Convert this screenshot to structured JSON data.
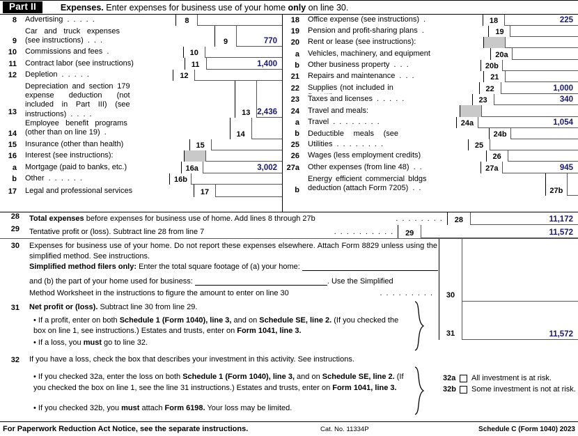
{
  "header": {
    "part_badge": "Part II",
    "title_bold": "Expenses.",
    "title_rest": " Enter expenses for business use of your home ",
    "title_bold2": "only",
    "title_end": " on line 30."
  },
  "left_column": [
    {
      "num": "8",
      "desc": "Advertising",
      "dots": 5,
      "linebox": "8",
      "amount": ""
    },
    {
      "num": "9",
      "desc": "Car and truck expenses (see instructions)",
      "dots": 3,
      "linebox": "9",
      "amount": "770"
    },
    {
      "num": "10",
      "desc": "Commissions and fees",
      "dots": 1,
      "linebox": "10",
      "amount": ""
    },
    {
      "num": "11",
      "desc": "Contract labor (see instructions)",
      "dots": 0,
      "linebox": "11",
      "amount": "1,400"
    },
    {
      "num": "12",
      "desc": "Depletion",
      "dots": 5,
      "linebox": "12",
      "amount": ""
    },
    {
      "num": "13",
      "desc": "Depreciation and section 179 expense deduction (not included in Part III) (see instructions)",
      "dots": 4,
      "linebox": "13",
      "amount": "2,436"
    },
    {
      "num": "14",
      "desc": "Employee benefit programs (other than on line 19)",
      "dots": 1,
      "linebox": "14",
      "amount": ""
    },
    {
      "num": "15",
      "desc": "Insurance (other than health)",
      "dots": 0,
      "linebox": "15",
      "amount": ""
    },
    {
      "num": "16",
      "desc": "Interest (see instructions):",
      "dots": 0,
      "linebox": "",
      "shaded": true,
      "amount": ""
    },
    {
      "num": "a",
      "desc": "Mortgage (paid to banks, etc.)",
      "dots": 0,
      "linebox": "16a",
      "amount": "3,002"
    },
    {
      "num": "b",
      "desc": "Other",
      "dots": 6,
      "linebox": "16b",
      "amount": ""
    },
    {
      "num": "17",
      "desc": "Legal and professional services",
      "dots": 0,
      "linebox": "17",
      "amount": ""
    }
  ],
  "right_column": [
    {
      "num": "18",
      "desc": "Office expense (see instructions)",
      "dots": 1,
      "linebox": "18",
      "amount": "225"
    },
    {
      "num": "19",
      "desc": "Pension and profit-sharing plans",
      "dots": 1,
      "linebox": "19",
      "amount": ""
    },
    {
      "num": "20",
      "desc": "Rent or lease (see instructions):",
      "dots": 0,
      "linebox": "",
      "shaded": true,
      "amount": ""
    },
    {
      "num": "a",
      "desc": "Vehicles, machinery, and equipment",
      "dots": 0,
      "linebox": "20a",
      "amount": ""
    },
    {
      "num": "b",
      "desc": "Other business property",
      "dots": 3,
      "linebox": "20b",
      "amount": ""
    },
    {
      "num": "21",
      "desc": "Repairs and maintenance",
      "dots": 3,
      "linebox": "21",
      "amount": ""
    },
    {
      "num": "22",
      "desc": "Supplies (not included in Part III)",
      "dots": 1,
      "linebox": "22",
      "amount": "1,000"
    },
    {
      "num": "23",
      "desc": "Taxes and licenses",
      "dots": 5,
      "linebox": "23",
      "amount": "340"
    },
    {
      "num": "24",
      "desc": "Travel and meals:",
      "dots": 0,
      "linebox": "",
      "shaded": true,
      "amount": ""
    },
    {
      "num": "a",
      "desc": "Travel",
      "dots": 8,
      "linebox": "24a",
      "amount": "1,054"
    },
    {
      "num": "b",
      "desc": "Deductible meals (see instructions)",
      "dots": 0,
      "linebox": "24b",
      "amount": ""
    },
    {
      "num": "25",
      "desc": "Utilities",
      "dots": 8,
      "linebox": "25",
      "amount": ""
    },
    {
      "num": "26",
      "desc": "Wages (less employment credits)",
      "dots": 0,
      "linebox": "26",
      "amount": ""
    },
    {
      "num": "27a",
      "desc": "Other expenses (from line 48)",
      "dots": 2,
      "linebox": "27a",
      "amount": "945"
    },
    {
      "num": "b",
      "desc": "Energy efficient commercial bldgs deduction (attach Form 7205)",
      "dots": 2,
      "linebox": "27b",
      "amount": ""
    }
  ],
  "line28": {
    "num": "28",
    "bold": "Total expenses",
    "text": " before expenses for business use of home. Add lines 8 through 27b",
    "linebox": "28",
    "amount": "11,172"
  },
  "line29": {
    "num": "29",
    "text": "Tentative profit or (loss). Subtract line 28 from line 7",
    "linebox": "29",
    "amount": "11,572"
  },
  "line30": {
    "num": "30",
    "para1": "Expenses for business use of your home. Do not report these expenses elsewhere. Attach Form 8829 unless using the simplified method. See instructions.",
    "bold_lead": "Simplified method filers only:",
    "para2": " Enter the total square footage of (a) your home:",
    "para3": "and (b) the part of your home used for business:",
    "para3b": ". Use the Simplified",
    "para4": "Method Worksheet in the instructions to figure the amount to enter on line 30",
    "home_sqft_value": "",
    "business_sqft_value": "",
    "linebox": "30",
    "amount": ""
  },
  "line31": {
    "num": "31",
    "bold": "Net profit or (loss).",
    "text": " Subtract line 30 from line 29.",
    "bullet1_a": "• If a profit, enter on both ",
    "bullet1_b": "Schedule 1 (Form 1040), line 3,",
    "bullet1_c": " and on ",
    "bullet1_d": "Schedule SE, line 2.",
    "bullet1_e": " (If you checked the box on line 1, see instructions.) Estates and trusts, enter on ",
    "bullet1_f": "Form 1041, line 3.",
    "bullet2_a": "• If a loss, you ",
    "bullet2_b": "must",
    "bullet2_c": "  go to line 32.",
    "linebox": "31",
    "amount": "11,572"
  },
  "line32": {
    "num": "32",
    "text": "If you have a loss, check the box that describes your investment in this activity. See instructions.",
    "bullet1_a": "• If you checked 32a, enter the loss on both ",
    "bullet1_b": "Schedule 1 (Form 1040), line 3,",
    "bullet1_c": " and on ",
    "bullet1_d": "Schedule",
    "bullet1_e": "SE, line 2.",
    "bullet1_f": " (If you checked the box on line 1, see the line 31 instructions.) Estates and trusts, enter on",
    "bullet1_g": "Form 1041, line 3.",
    "bullet2_a": "• If you checked 32b, you ",
    "bullet2_b": "must",
    "bullet2_c": " attach ",
    "bullet2_d": "Form 6198.",
    "bullet2_e": " Your loss may be limited.",
    "checkboxes": [
      {
        "num": "32a",
        "label": "All investment is at risk."
      },
      {
        "num": "32b",
        "label": "Some investment is not at risk."
      }
    ]
  },
  "footer": {
    "left": "For Paperwork Reduction Act Notice, see the separate instructions.",
    "center": "Cat. No. 11334P",
    "right": "Schedule C (Form 1040) 2023"
  },
  "colors": {
    "value_ink": "#191970",
    "rule": "#555555",
    "shade": "#c9c9c9"
  }
}
